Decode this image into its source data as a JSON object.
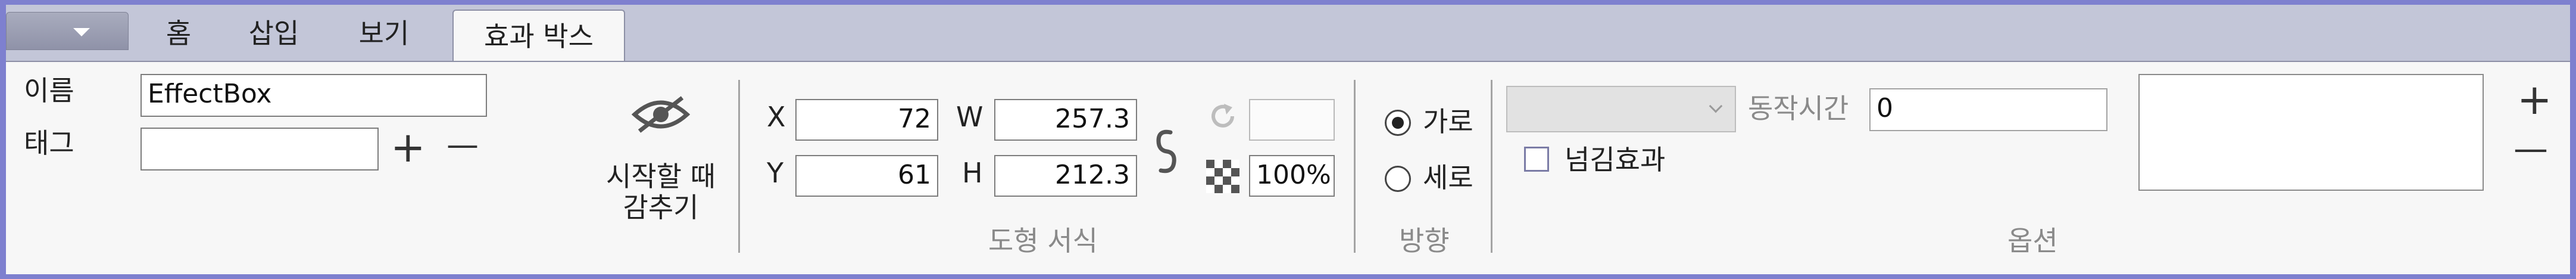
{
  "tabs": [
    "홈",
    "삽입",
    "보기",
    "효과 박스"
  ],
  "name_label": "이름",
  "name_value": "EffectBox",
  "tag_label": "태그",
  "tag_value": "",
  "tag_add": "+",
  "tag_remove": "—",
  "hide_on_start_line1": "시작할 때",
  "hide_on_start_line2": "감추기",
  "shape": {
    "x_label": "X",
    "x_value": "72",
    "y_label": "Y",
    "y_value": "61",
    "w_label": "W",
    "w_value": "257.3",
    "h_label": "H",
    "h_value": "212.3",
    "rotation_value": "",
    "opacity_value": "100%",
    "group_label": "도형 서식"
  },
  "direction": {
    "horizontal_label": "가로",
    "vertical_label": "세로",
    "selected": "가로",
    "group_label": "방향"
  },
  "options": {
    "duration_label": "동작시간",
    "duration_value": "0",
    "page_flip_label": "넘김효과",
    "page_flip_checked": false,
    "group_label": "옵션",
    "add": "+",
    "remove": "—"
  },
  "colors": {
    "frame": "#7e80cf",
    "tabbar": "#c3c6d8",
    "ribbon": "#f7f7f7"
  }
}
